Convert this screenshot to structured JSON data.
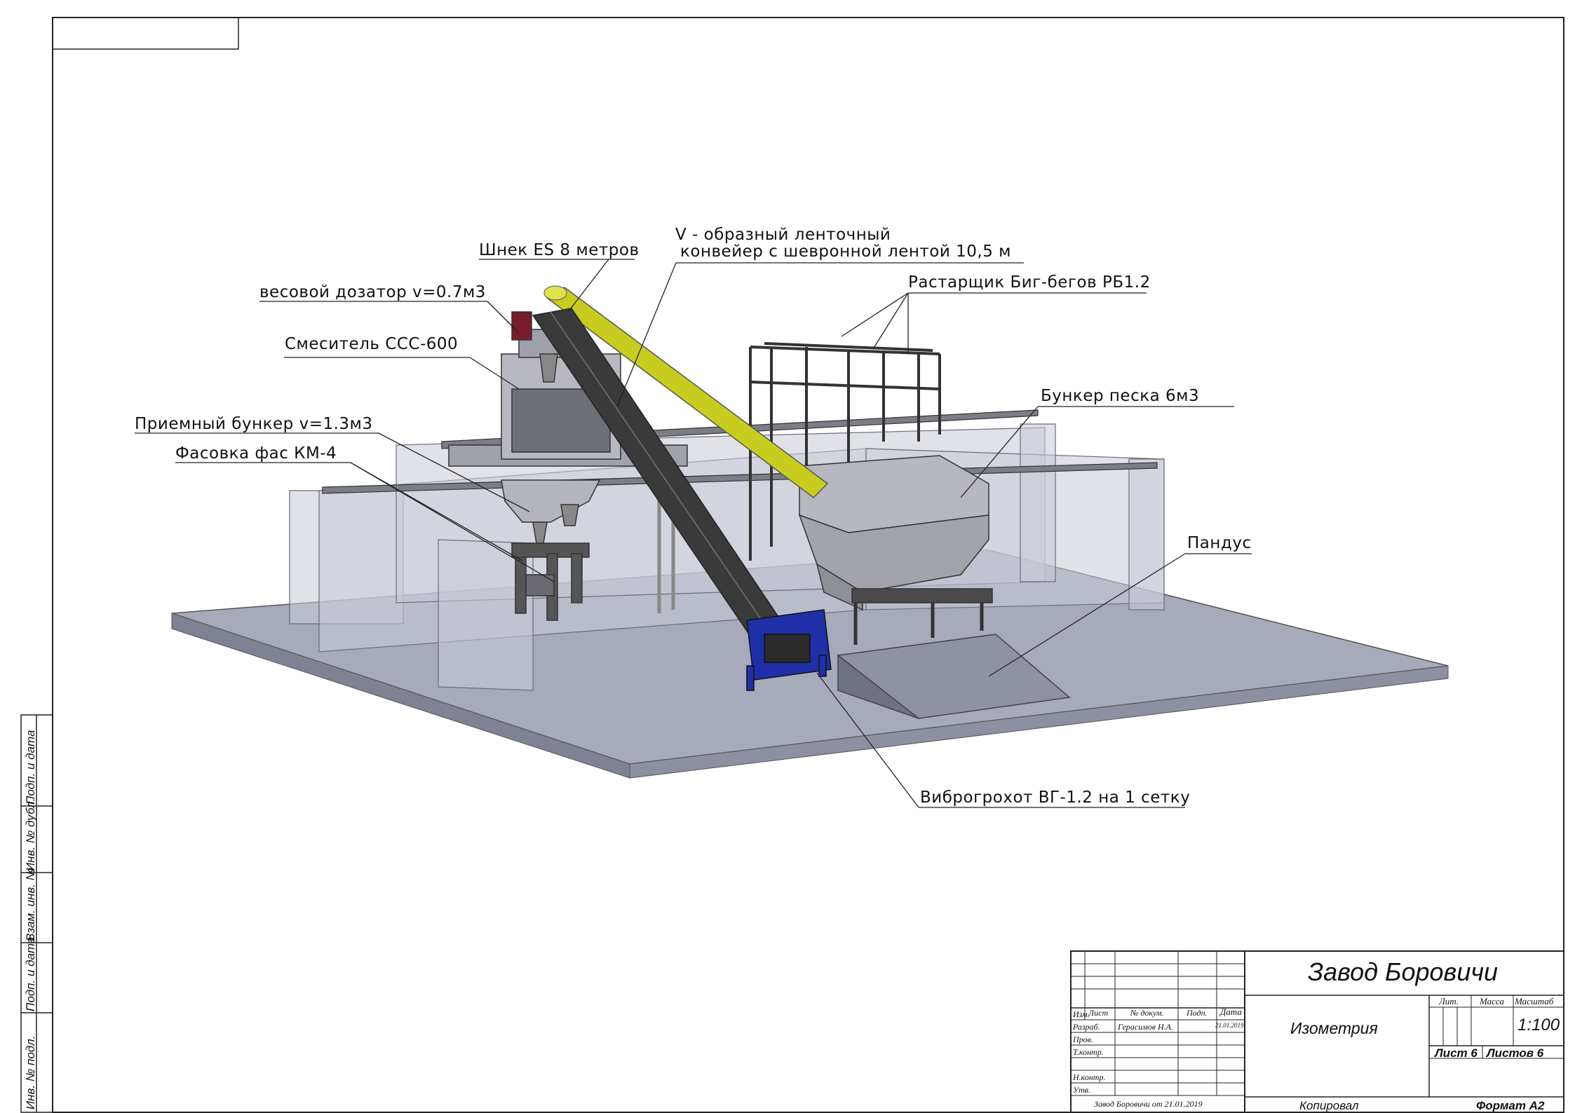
{
  "labels": {
    "screw": "Шнек ES 8 метров",
    "conveyor_line1": "V - образный ленточный",
    "conveyor_line2": "конвейер с шевронной лентой 10,5 м",
    "dispenser": "весовой дозатор v=0.7м3",
    "mixer": "Смеситель ССС-600",
    "bigbag": "Растарщик Биг-бегов РБ1.2",
    "sand_bunker": "Бункер песка 6м3",
    "receiving_bunker": "Приемный бункер v=1.3м3",
    "packing": "Фасовка фас КМ-4",
    "ramp": "Пандус",
    "screen": "Виброгрохот ВГ-1.2 на 1 сетку"
  },
  "title_block": {
    "plant": "Завод Боровичи",
    "view": "Изометрия",
    "scale": "1:100",
    "lit_header": "Лит.",
    "mass_header": "Масса",
    "scale_header": "Масштаб",
    "sheet": "Лист 6",
    "sheets": "Листов 6",
    "col_izm": "Изм.",
    "col_list": "Лист",
    "col_doc": "№ докум.",
    "col_sign": "Подп.",
    "col_date": "Дата",
    "role_dev": "Разраб.",
    "role_check": "Пров.",
    "role_tcontrol": "Т.контр.",
    "role_ncontrol": "Н.контр.",
    "role_approve": "Утв.",
    "developer": "Герасимов Н.А.",
    "date": "21.01.2019",
    "file_note": "Завод Боровичи от 21.01.2019",
    "copied": "Копировал",
    "format": "Формат А2"
  },
  "side_stamp": {
    "f1": "Инв. № подл.",
    "f2": "Подп. и дата",
    "f3": "Взам. инв. №",
    "f4": "Инв. № дубл.",
    "f5": "Подп. и дата"
  },
  "colors": {
    "slab_top": "#a7aabb",
    "slab_edge": "#7f8294",
    "glass": "#c9cbd6",
    "steel": "#9a9a9e",
    "conveyor": "#3a3a3a",
    "screw": "#c8cc1e",
    "blue_frame": "#1f2fa8"
  }
}
